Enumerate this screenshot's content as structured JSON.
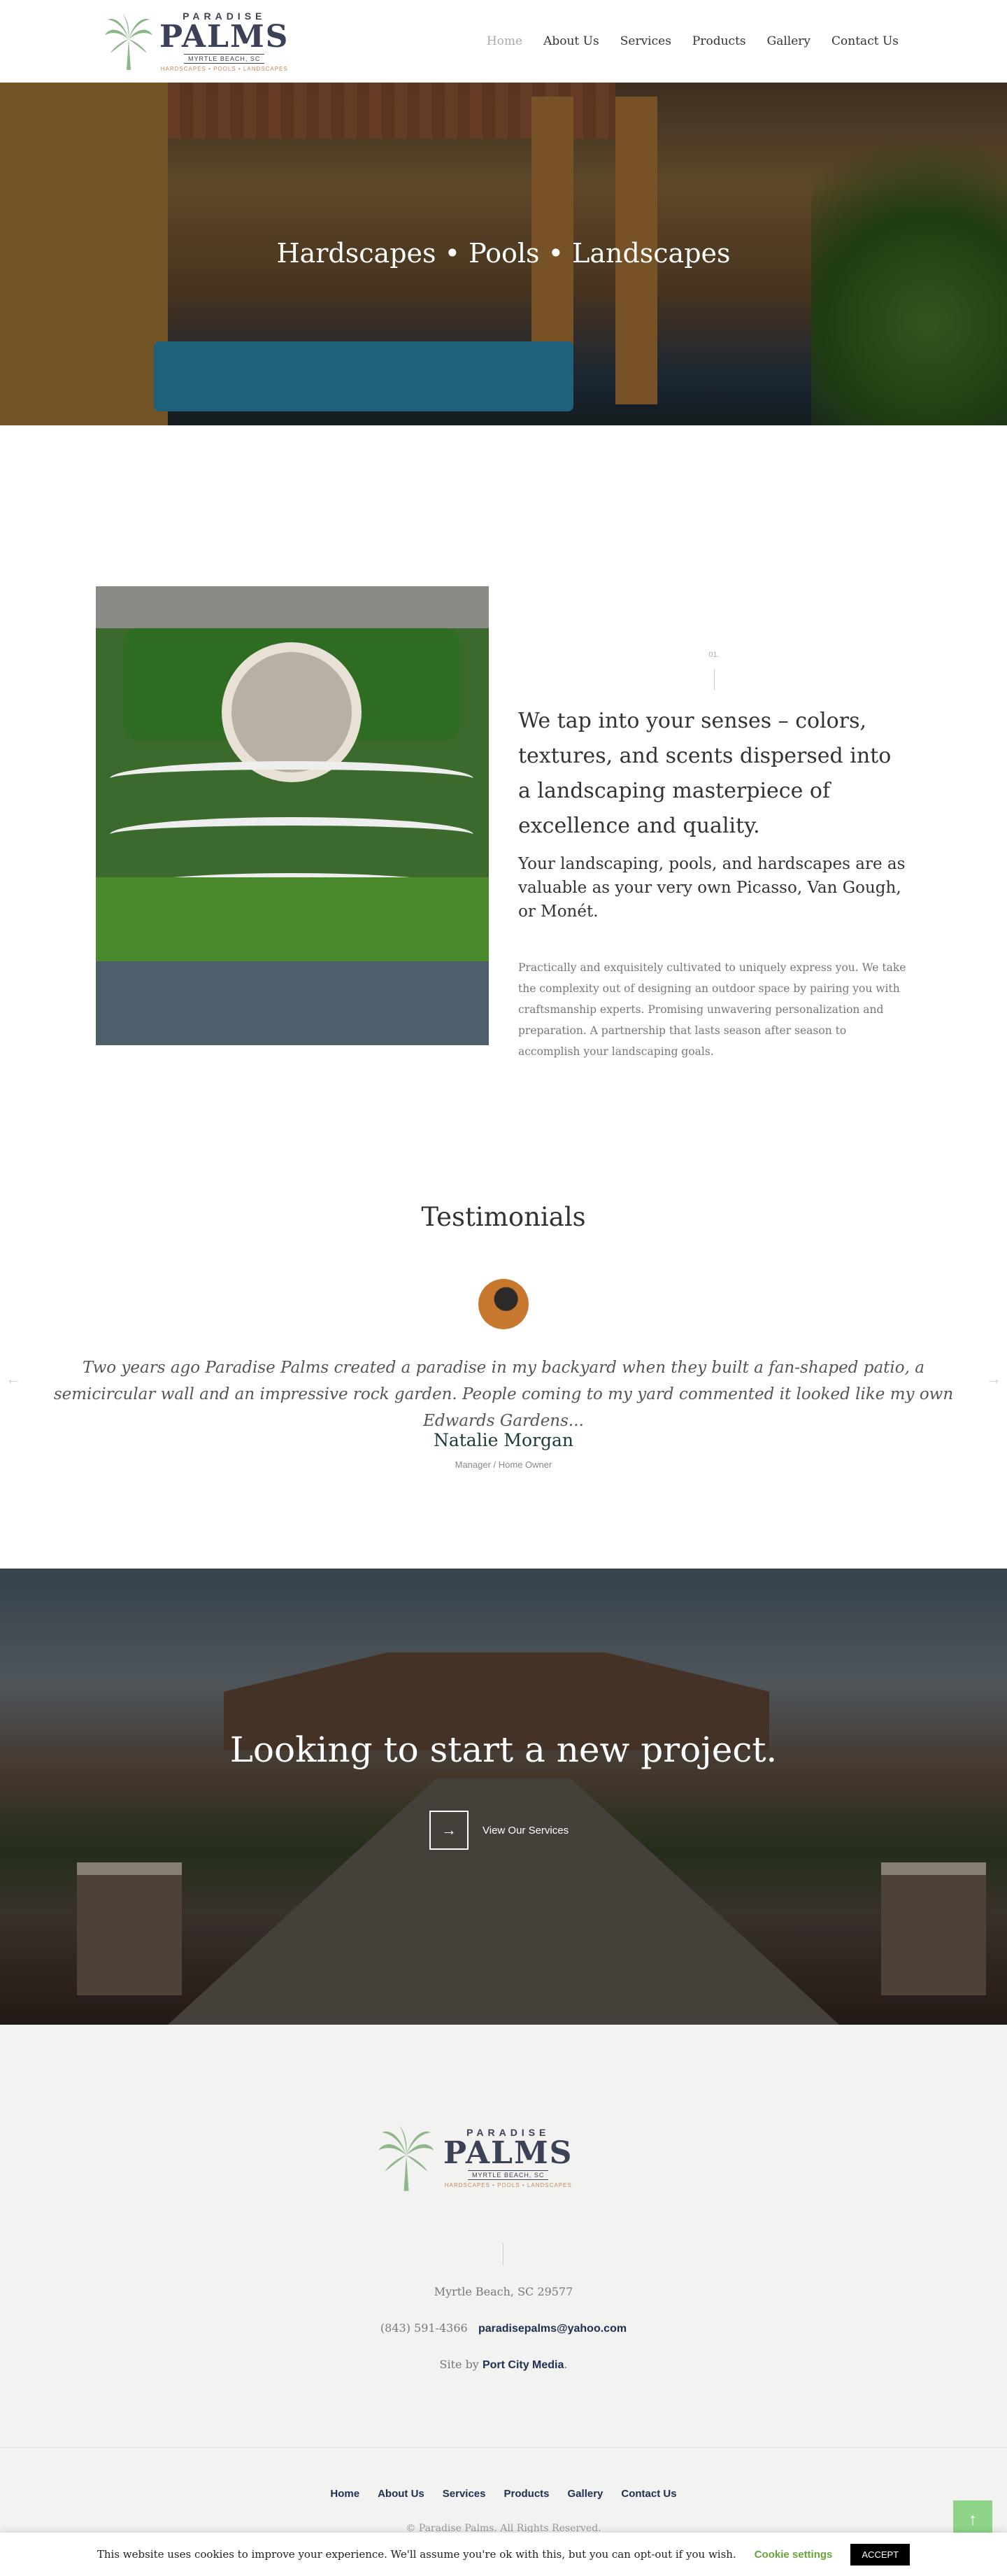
{
  "header": {
    "logo": {
      "small": "PARADISE",
      "big": "PALMS",
      "sub": "MYRTLE BEACH, SC",
      "tag": "HARDSCAPES • POOLS • LANDSCAPES"
    },
    "nav": [
      "Home",
      "About Us",
      "Services",
      "Products",
      "Gallery",
      "Contact Us"
    ],
    "active_nav": "Home"
  },
  "hero": {
    "title": "Hardscapes • Pools • Landscapes"
  },
  "about": {
    "number": "01.",
    "lead": "We tap into your senses – colors, textures, and scents dispersed into a landscaping masterpiece of excellence and quality.",
    "lead2": "Your landscaping, pools, and hardscapes are as valuable as your very own Picasso, Van Gough, or Monét.",
    "body": "Practically and exquisitely cultivated to uniquely express you. We take the complexity out of designing an outdoor space by pairing you with craftsmanship experts. Promising unwavering personalization and preparation. A partnership that lasts season after season to accomplish your landscaping goals."
  },
  "testimonials": {
    "title": "Testimonials",
    "quote": "Two years ago Paradise Palms created a paradise in my backyard when they built a fan-shaped patio, a semicircular wall and an impressive rock garden. People coming to my yard commented it looked like my own Edwards Gardens...",
    "name": "Natalie Morgan",
    "role": "Manager / Home Owner",
    "prev_icon": "←",
    "next_icon": "→"
  },
  "cta": {
    "title": "Looking to start a new project.",
    "button_label": "View Our Services",
    "button_icon": "→"
  },
  "footer": {
    "logo": {
      "small": "PARADISE",
      "big": "PALMS",
      "sub": "MYRTLE BEACH, SC",
      "tag": "HARDSCAPES • POOLS • LANDSCAPES"
    },
    "address": "Myrtle Beach, SC 29577",
    "phone": "(843) 591-4366",
    "email": "paradisepalms@yahoo.com",
    "site_prefix": "Site by",
    "site_link": "Port City Media",
    "site_suffix": ".",
    "nav": [
      "Home",
      "About Us",
      "Services",
      "Products",
      "Gallery",
      "Contact Us"
    ],
    "copyright": "© Paradise Palms. All Rights Reserved."
  },
  "cookie": {
    "message": "This website uses cookies to improve your experience. We'll assume you're ok with this, but you can opt-out if you wish.",
    "settings_label": "Cookie settings",
    "accept_label": "ACCEPT"
  },
  "back_to_top_icon": "↑",
  "colors": {
    "brand_navy": "#3b4257",
    "accent_green": "#6aa33a",
    "palm_green": "#8fb58a",
    "tag_orange": "#c9865a"
  }
}
